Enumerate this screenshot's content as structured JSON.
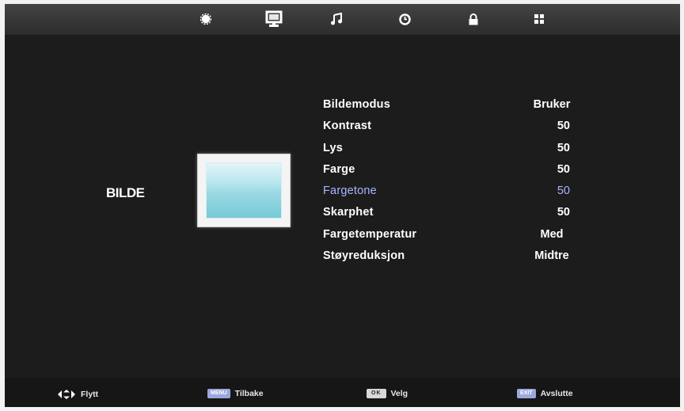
{
  "tabs": [
    {
      "id": "setup",
      "icon": "gear-icon"
    },
    {
      "id": "picture",
      "icon": "monitor-icon",
      "active": true
    },
    {
      "id": "sound",
      "icon": "music-note-icon"
    },
    {
      "id": "time",
      "icon": "clock-icon"
    },
    {
      "id": "lock",
      "icon": "lock-icon"
    },
    {
      "id": "apps",
      "icon": "grid-icon"
    }
  ],
  "menu": {
    "title": "BILDE",
    "items": [
      {
        "label": "Bildemodus",
        "value": "Bruker"
      },
      {
        "label": "Kontrast",
        "value": "50"
      },
      {
        "label": "Lys",
        "value": "50"
      },
      {
        "label": "Farge",
        "value": "50"
      },
      {
        "label": "Fargetone",
        "value": "50",
        "selected": true
      },
      {
        "label": "Skarphet",
        "value": "50"
      },
      {
        "label": "Fargetemperatur",
        "value": "Med"
      },
      {
        "label": "Støyreduksjon",
        "value": "Midtre"
      }
    ]
  },
  "hints": {
    "move": {
      "text": "Flytt",
      "icon": "directional-arrows-icon"
    },
    "back": {
      "key": "MENU",
      "text": "Tilbake"
    },
    "select": {
      "key": "OK",
      "text": "Velg"
    },
    "exit": {
      "key": "EXIT",
      "text": "Avslutte"
    }
  },
  "colors": {
    "background": "#1c1c1c",
    "text": "#ffffff",
    "selected_text": "#a9b6ff",
    "key_badge": "#9ca7df"
  }
}
